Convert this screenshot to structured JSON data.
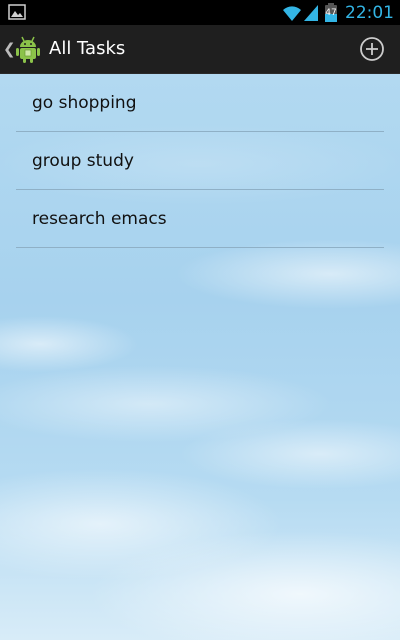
{
  "status_bar": {
    "time": "22:01",
    "battery_percent": "47",
    "battery_level": 0.47,
    "accent_color": "#33b5e5",
    "icons": [
      "image-icon",
      "wifi-icon",
      "signal-icon",
      "battery-icon"
    ]
  },
  "action_bar": {
    "title": "All Tasks",
    "up_icon": "chevron-left-icon",
    "app_icon": "android-icon",
    "add_icon": "add-circle-icon"
  },
  "tasks": [
    {
      "label": "go shopping"
    },
    {
      "label": "group study"
    },
    {
      "label": "research emacs"
    }
  ]
}
